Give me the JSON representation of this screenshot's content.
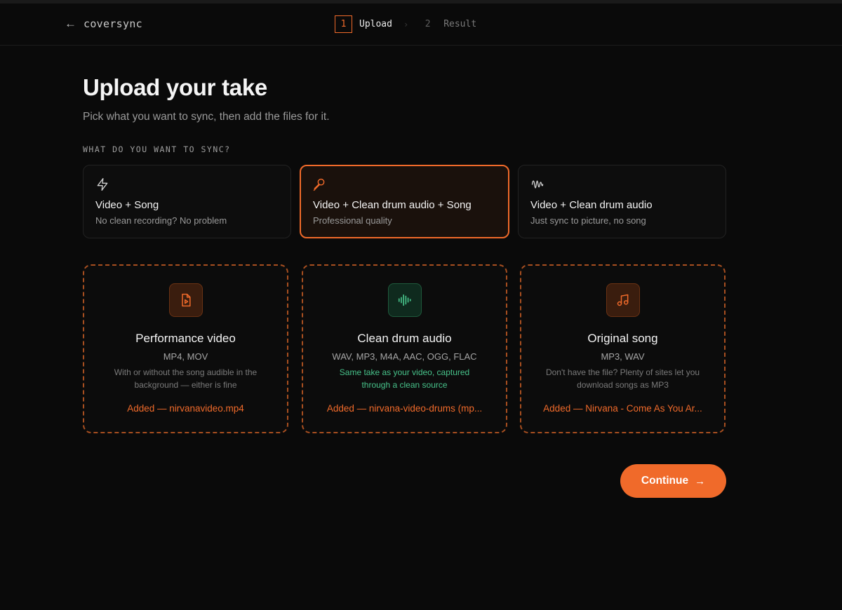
{
  "header": {
    "back_icon": "arrow-left-icon",
    "brand": "coversync",
    "steps": [
      {
        "number": "1",
        "label": "Upload",
        "active": true
      },
      {
        "number": "2",
        "label": "Result",
        "active": false
      }
    ],
    "step_separator": "›"
  },
  "page": {
    "title": "Upload your take",
    "subtitle": "Pick what you want to sync, then add the files for it.",
    "section_label": "WHAT DO YOU WANT TO SYNC?"
  },
  "modes": [
    {
      "icon": "lightning-icon",
      "title": "Video + Song",
      "description": "No clean recording? No problem",
      "selected": false
    },
    {
      "icon": "microphone-icon",
      "title": "Video + Clean drum audio + Song",
      "description": "Professional quality",
      "selected": true
    },
    {
      "icon": "waveform-icon",
      "title": "Video + Clean drum audio",
      "description": "Just sync to picture, no song",
      "selected": false
    }
  ],
  "uploads": [
    {
      "icon": "video-file-icon",
      "title": "Performance video",
      "formats": "MP4, MOV",
      "note": "With or without the song audible in the background — either is fine",
      "added": "Added — nirvanavideo.mp4"
    },
    {
      "icon": "audio-waveform-icon",
      "title": "Clean drum audio",
      "formats": "WAV, MP3, M4A, AAC, OGG, FLAC",
      "note": "Same take as your video, captured through a clean source",
      "added": "Added — nirvana-video-drums (mp..."
    },
    {
      "icon": "music-note-icon",
      "title": "Original song",
      "formats": "MP3, WAV",
      "note": "Don't have the file? Plenty of sites let you download songs as MP3",
      "added": "Added — Nirvana - Come As You Ar..."
    }
  ],
  "actions": {
    "continue_label": "Continue",
    "continue_icon": "arrow-right-icon"
  },
  "colors": {
    "accent": "#f06a2a",
    "background": "#0a0a0a",
    "note_green": "#47c28a"
  }
}
